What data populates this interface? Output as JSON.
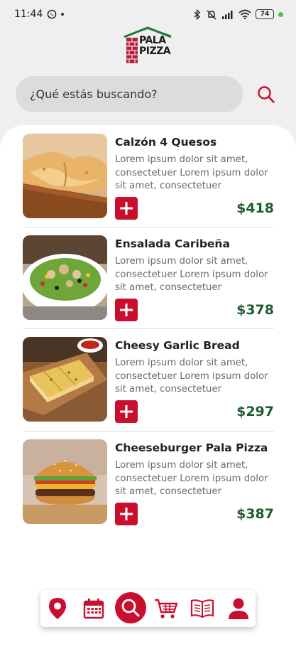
{
  "status_bar": {
    "time": "11:44",
    "battery": "74"
  },
  "logo": {
    "line1": "PALA",
    "line2": "PIZZA"
  },
  "search": {
    "placeholder": "¿Qué estás buscando?"
  },
  "products": [
    {
      "name": "Calzón 4 Quesos",
      "description": "Lorem ipsum dolor sit amet, consectetuer Lorem ipsum dolor sit amet, consectetuer",
      "price": "$418",
      "image": "calzone-image"
    },
    {
      "name": "Ensalada Caribeña",
      "description": "Lorem ipsum dolor sit amet, consectetuer Lorem ipsum dolor sit amet, consectetuer",
      "price": "$378",
      "image": "salad-image"
    },
    {
      "name": "Cheesy Garlic Bread",
      "description": "Lorem ipsum dolor sit amet, consectetuer Lorem ipsum dolor sit amet, consectetuer",
      "price": "$297",
      "image": "garlic-bread-image"
    },
    {
      "name": "Cheeseburger Pala Pizza",
      "description": "Lorem ipsum dolor sit amet, consectetuer Lorem ipsum dolor sit amet, consectetuer",
      "price": "$387",
      "image": "burger-image"
    }
  ],
  "bottom_nav": {
    "items": [
      "location-icon",
      "calendar-icon",
      "search-icon",
      "cart-icon",
      "menu-book-icon",
      "profile-icon"
    ],
    "active": "search-icon"
  },
  "colors": {
    "accent": "#c8102e",
    "price": "#1d5e2f",
    "background": "#efefef"
  }
}
